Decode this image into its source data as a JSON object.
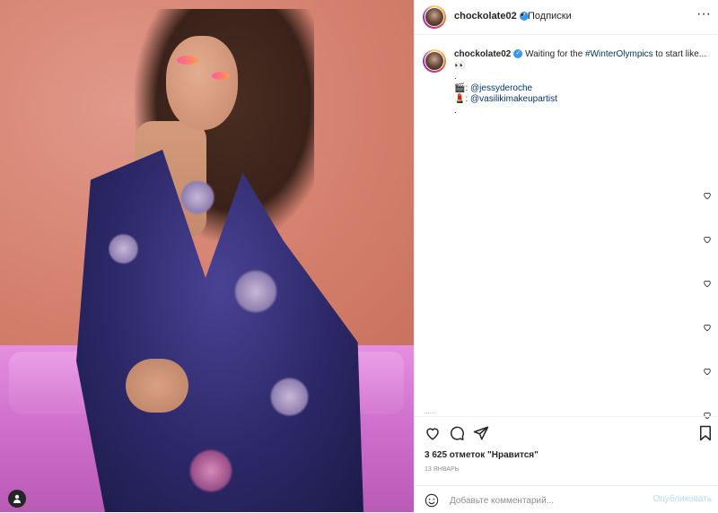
{
  "post": {
    "username": "chockolate02",
    "separator": "•",
    "follow_label": "Подписки",
    "more_label": "···",
    "caption_username": "chockolate02",
    "caption_text_1": "Waiting for the",
    "caption_hashtag": "#WinterOlympics",
    "caption_text_2": "to start like...👀",
    "caption_dot_1": ".",
    "credit_1_icon": "🎬",
    "credit_1_mention": "@jessyderoche",
    "credit_2_icon": "💄",
    "credit_2_mention": "@vasilikimakeupartist",
    "caption_dot_2": ".",
    "faded_text": "......",
    "likes": "3 625 отметок \"Нравится\"",
    "date": "13 ЯНВАРЬ",
    "comment_placeholder": "Добавьте комментарий...",
    "publish_label": "Опубликовать"
  },
  "icons": [
    "verified-icon",
    "more-icon",
    "heart-icon",
    "comment-icon",
    "share-icon",
    "bookmark-icon",
    "emoji-icon",
    "user-tag-icon"
  ],
  "colors": {
    "link": "#00376b",
    "verified": "#3897f0",
    "publish_disabled": "#b3dbff"
  }
}
